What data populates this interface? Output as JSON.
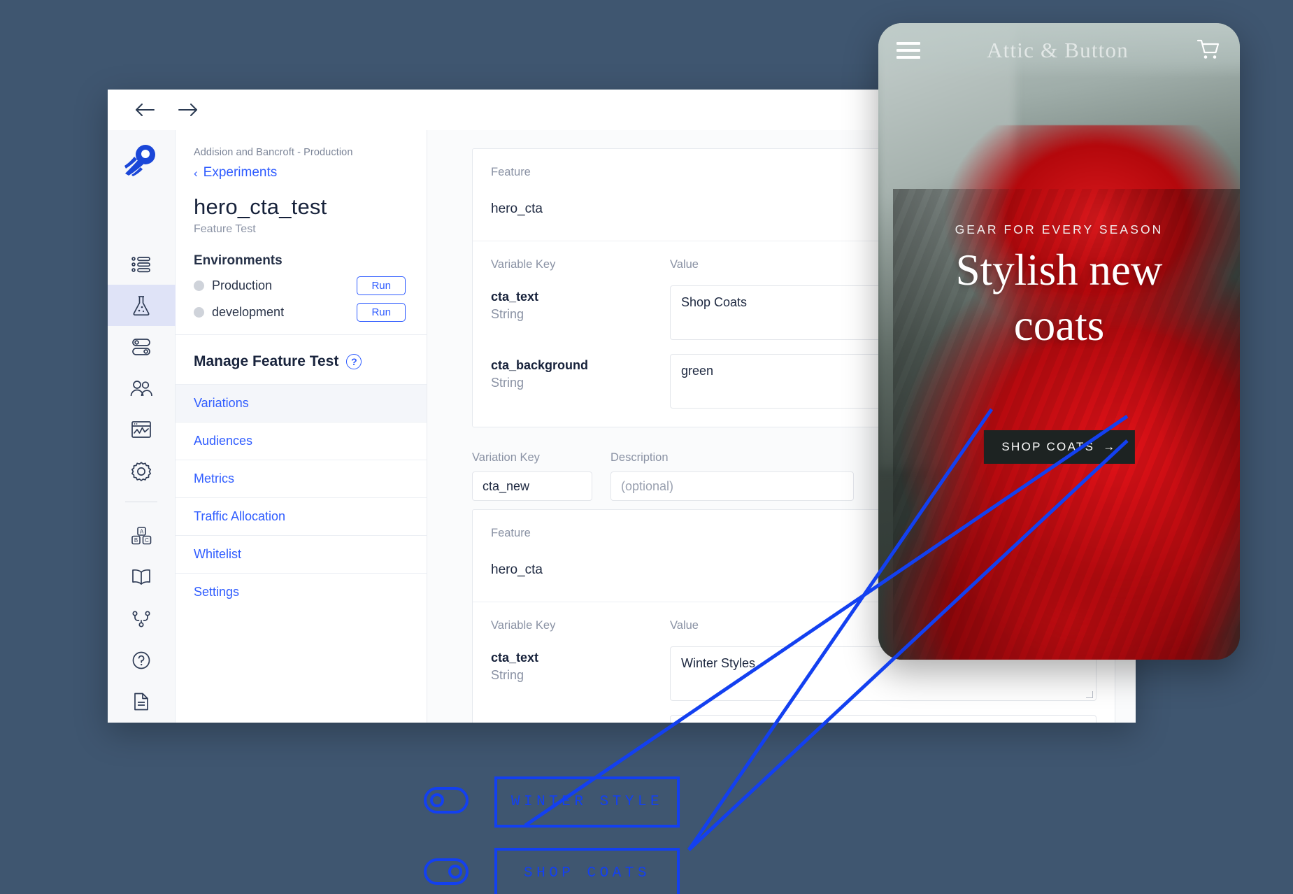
{
  "app": {
    "topbar": {
      "back_icon": "arrow-left-icon",
      "forward_icon": "arrow-right-icon"
    },
    "rail": {
      "logo_icon": "optimizely-rocket-logo",
      "items": [
        {
          "icon": "list-icon",
          "name": "features"
        },
        {
          "icon": "flask-icon",
          "name": "experiments"
        },
        {
          "icon": "toggles-icon",
          "name": "feature-flags"
        },
        {
          "icon": "audience-icon",
          "name": "audiences"
        },
        {
          "icon": "chart-icon",
          "name": "results"
        },
        {
          "icon": "gear-icon",
          "name": "settings"
        },
        {
          "icon": "abc-blocks-icon",
          "name": "glossary"
        },
        {
          "icon": "book-icon",
          "name": "docs"
        },
        {
          "icon": "branch-icon",
          "name": "integrations"
        },
        {
          "icon": "question-icon",
          "name": "help"
        },
        {
          "icon": "document-icon",
          "name": "changelog"
        }
      ]
    },
    "side_panel": {
      "org": "Addision and Bancroft - Production",
      "back_link": "Experiments",
      "back_chevron": "‹",
      "title": "hero_cta_test",
      "subtitle": "Feature Test",
      "environments_label": "Environments",
      "environments": [
        {
          "name": "Production",
          "action": "Run"
        },
        {
          "name": "development",
          "action": "Run"
        }
      ],
      "manage_label": "Manage Feature Test",
      "help_glyph": "?",
      "nav": [
        {
          "label": "Variations",
          "active": true
        },
        {
          "label": "Audiences",
          "active": false
        },
        {
          "label": "Metrics",
          "active": false
        },
        {
          "label": "Traffic Allocation",
          "active": false
        },
        {
          "label": "Whitelist",
          "active": false
        },
        {
          "label": "Settings",
          "active": false
        }
      ]
    },
    "main": {
      "variation_1": {
        "feature_label": "Feature",
        "feature_name": "hero_cta",
        "toggle_state": "On",
        "variable_key_label": "Variable Key",
        "value_label": "Value",
        "variables": [
          {
            "key": "cta_text",
            "type": "String",
            "value": "Shop Coats"
          },
          {
            "key": "cta_background",
            "type": "String",
            "value": "green"
          }
        ]
      },
      "variation_2": {
        "variation_key_label": "Variation Key",
        "description_label": "Description",
        "variation_key_value": "cta_new",
        "description_placeholder": "(optional)",
        "feature_label": "Feature",
        "feature_name": "hero_cta",
        "toggle_state": "On",
        "variable_key_label": "Variable Key",
        "value_label": "Value",
        "variables": [
          {
            "key": "cta_text",
            "type": "String",
            "value": "Winter Styles"
          }
        ]
      }
    }
  },
  "phone": {
    "menu_icon": "hamburger-menu-icon",
    "brand": "Attic & Button",
    "cart_icon": "shopping-cart-icon",
    "hero_kicker": "GEAR FOR EVERY SEASON",
    "hero_title_line1": "Stylish new",
    "hero_title_line2": "coats",
    "cta_label": "SHOP COATS",
    "cta_arrow": "→"
  },
  "wireframe": {
    "accent_color": "#1340f0",
    "items": [
      {
        "toggle_state": "off",
        "button_label": "WINTER STYLE"
      },
      {
        "toggle_state": "on",
        "button_label": "SHOP COATS"
      }
    ]
  }
}
